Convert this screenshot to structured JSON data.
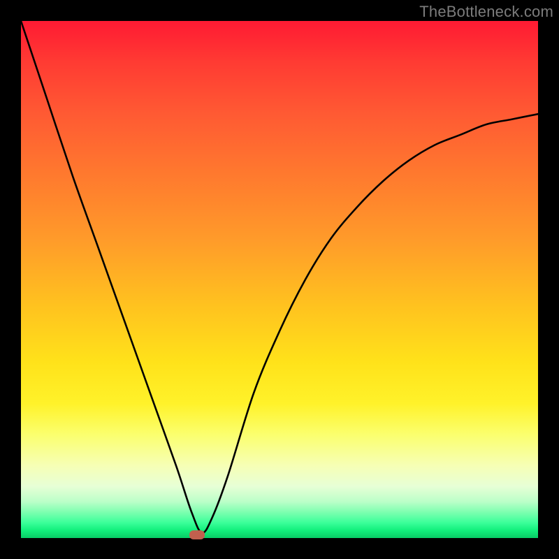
{
  "watermark": "TheBottleneck.com",
  "chart_data": {
    "type": "line",
    "title": "",
    "xlabel": "",
    "ylabel": "",
    "xlim": [
      0,
      100
    ],
    "ylim": [
      0,
      100
    ],
    "grid": false,
    "series": [
      {
        "name": "bottleneck-curve",
        "x": [
          0,
          5,
          10,
          15,
          20,
          25,
          30,
          33,
          35,
          37,
          40,
          45,
          50,
          55,
          60,
          65,
          70,
          75,
          80,
          85,
          90,
          95,
          100
        ],
        "values": [
          100,
          85,
          70,
          56,
          42,
          28,
          14,
          5,
          1,
          4,
          12,
          28,
          40,
          50,
          58,
          64,
          69,
          73,
          76,
          78,
          80,
          81,
          82
        ]
      }
    ],
    "marker": {
      "x": 34,
      "y": 0.5,
      "color": "#c1604e"
    },
    "gradient_stops": [
      {
        "pos": 0,
        "color": "#ff1a33"
      },
      {
        "pos": 50,
        "color": "#ffc21f"
      },
      {
        "pos": 80,
        "color": "#fbff6e"
      },
      {
        "pos": 100,
        "color": "#08cc66"
      }
    ]
  }
}
